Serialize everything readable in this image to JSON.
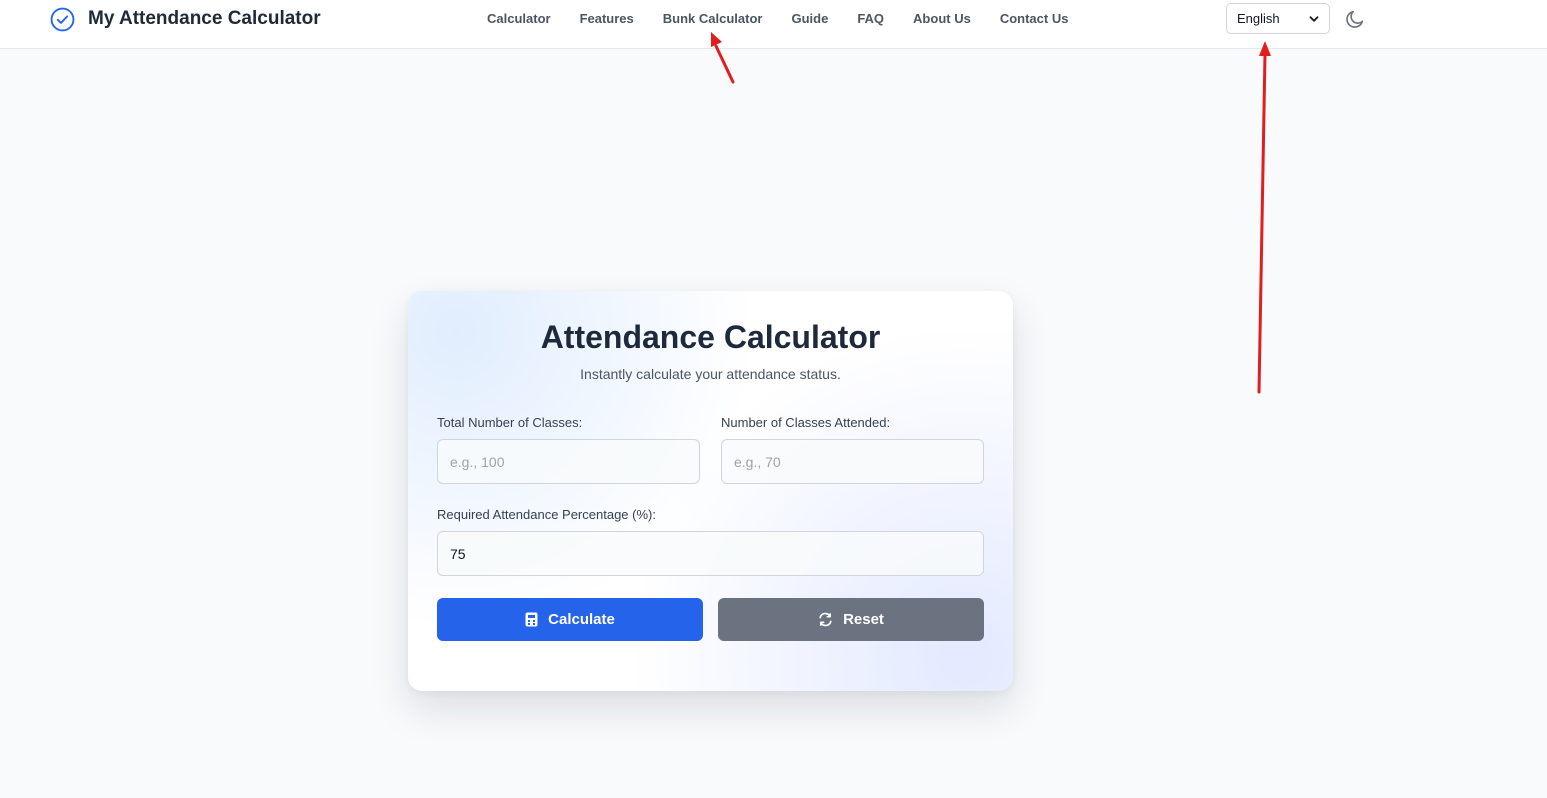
{
  "header": {
    "brand_title": "My Attendance Calculator",
    "brand_icon": "check-circle-icon",
    "nav": [
      {
        "label": "Calculator"
      },
      {
        "label": "Features"
      },
      {
        "label": "Bunk Calculator"
      },
      {
        "label": "Guide"
      },
      {
        "label": "FAQ"
      },
      {
        "label": "About Us"
      },
      {
        "label": "Contact Us"
      }
    ],
    "language": {
      "selected": "English"
    },
    "theme_icon": "moon-icon"
  },
  "calculator": {
    "title": "Attendance Calculator",
    "subtitle": "Instantly calculate your attendance status.",
    "total_classes": {
      "label": "Total Number of Classes:",
      "placeholder": "e.g., 100",
      "value": ""
    },
    "attended_classes": {
      "label": "Number of Classes Attended:",
      "placeholder": "e.g., 70",
      "value": ""
    },
    "required_percentage": {
      "label": "Required Attendance Percentage (%):",
      "value": "75"
    },
    "calculate_label": "Calculate",
    "reset_label": "Reset"
  },
  "colors": {
    "primary": "#2563eb",
    "secondary": "#6b7280",
    "annotation": "#e11d1d"
  }
}
